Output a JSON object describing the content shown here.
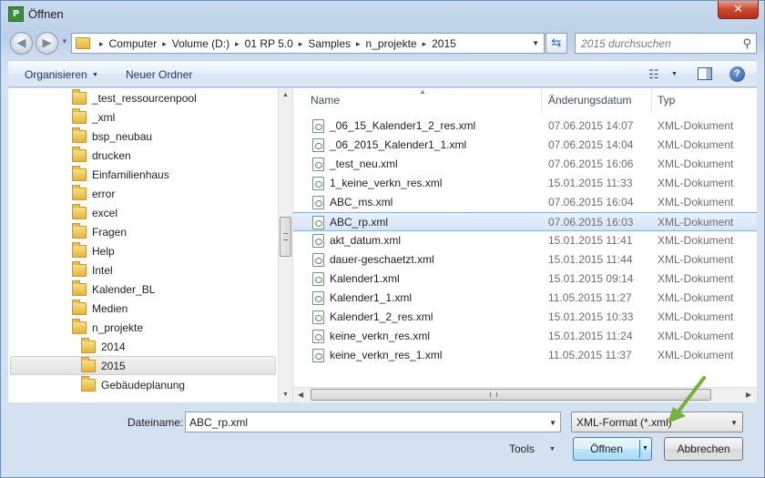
{
  "window": {
    "title": "Öffnen",
    "app_icon_text": "P",
    "close_glyph": "✕"
  },
  "address_bar": {
    "crumbs": [
      "Computer",
      "Volume (D:)",
      "01 RP 5.0",
      "Samples",
      "n_projekte",
      "2015"
    ]
  },
  "search": {
    "placeholder": "2015 durchsuchen"
  },
  "toolbar": {
    "organize_label": "Organisieren",
    "new_folder_label": "Neuer Ordner"
  },
  "tree": {
    "items": [
      {
        "label": "_test_ressourcenpool",
        "level": 0
      },
      {
        "label": "_xml",
        "level": 0
      },
      {
        "label": "bsp_neubau",
        "level": 0
      },
      {
        "label": "drucken",
        "level": 0
      },
      {
        "label": "Einfamilienhaus",
        "level": 0
      },
      {
        "label": "error",
        "level": 0
      },
      {
        "label": "excel",
        "level": 0
      },
      {
        "label": "Fragen",
        "level": 0
      },
      {
        "label": "Help",
        "level": 0
      },
      {
        "label": "Intel",
        "level": 0
      },
      {
        "label": "Kalender_BL",
        "level": 0
      },
      {
        "label": "Medien",
        "level": 0
      },
      {
        "label": "n_projekte",
        "level": 0
      },
      {
        "label": "2014",
        "level": 1
      },
      {
        "label": "2015",
        "level": 1,
        "selected": true
      },
      {
        "label": "Gebäudeplanung",
        "level": 1
      }
    ]
  },
  "files": {
    "columns": {
      "name": "Name",
      "date": "Änderungsdatum",
      "type": "Typ"
    },
    "rows": [
      {
        "name": "_06_15_Kalender1_2_res.xml",
        "date": "07.06.2015 14:07",
        "type": "XML-Dokument"
      },
      {
        "name": "_06_2015_Kalender1_1.xml",
        "date": "07.06.2015 14:04",
        "type": "XML-Dokument"
      },
      {
        "name": "_test_neu.xml",
        "date": "07.06.2015 16:06",
        "type": "XML-Dokument"
      },
      {
        "name": "1_keine_verkn_res.xml",
        "date": "15.01.2015 11:33",
        "type": "XML-Dokument"
      },
      {
        "name": "ABC_ms.xml",
        "date": "07.06.2015 16:04",
        "type": "XML-Dokument"
      },
      {
        "name": "ABC_rp.xml",
        "date": "07.06.2015 16:03",
        "type": "XML-Dokument",
        "selected": true
      },
      {
        "name": "akt_datum.xml",
        "date": "15.01.2015 11:41",
        "type": "XML-Dokument"
      },
      {
        "name": "dauer-geschaetzt.xml",
        "date": "15.01.2015 11:44",
        "type": "XML-Dokument"
      },
      {
        "name": "Kalender1.xml",
        "date": "15.01.2015 09:14",
        "type": "XML-Dokument"
      },
      {
        "name": "Kalender1_1.xml",
        "date": "11.05.2015 11:27",
        "type": "XML-Dokument"
      },
      {
        "name": "Kalender1_2_res.xml",
        "date": "15.01.2015 10:33",
        "type": "XML-Dokument"
      },
      {
        "name": "keine_verkn_res.xml",
        "date": "15.01.2015 11:24",
        "type": "XML-Dokument"
      },
      {
        "name": "keine_verkn_res_1.xml",
        "date": "11.05.2015 11:37",
        "type": "XML-Dokument"
      }
    ]
  },
  "footer": {
    "filename_label": "Dateiname:",
    "filename_value": "ABC_rp.xml",
    "filter_value": "XML-Format (*.xml)",
    "tools_label": "Tools",
    "open_label": "Öffnen",
    "cancel_label": "Abbrechen"
  },
  "colors": {
    "accent": "#3c7fb1",
    "annotation_arrow": "#74b23a",
    "selection": "#d5e5f9"
  }
}
